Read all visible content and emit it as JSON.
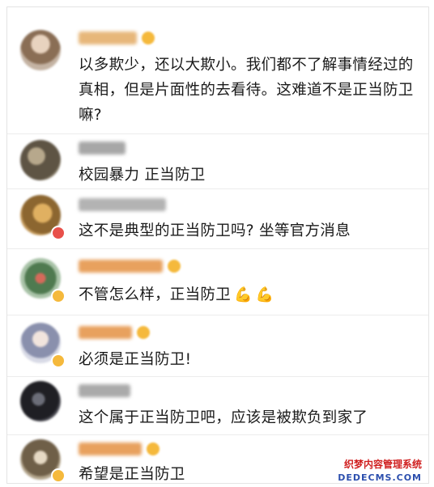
{
  "comments": [
    {
      "text": "以多欺少，还以大欺小。我们都不了解事情经过的真相，但是片面性的去看待。这难道不是正当防卫嘛?",
      "avatar_color": "#b69a7e",
      "name_color": "#e7b77a"
    },
    {
      "text": "校园暴力  正当防卫",
      "avatar_color": "#786a58",
      "name_color": "#9a9a9a"
    },
    {
      "text": "这不是典型的正当防卫吗? 坐等官方消息",
      "avatar_color": "#a9813e",
      "name_color": "#a8a8a8"
    },
    {
      "text": "不管怎么样，正当防卫",
      "avatar_color": "#5b7d5a",
      "name_color": "#e8a15e",
      "icons": [
        "flexed-biceps-icon",
        "flexed-biceps-icon"
      ]
    },
    {
      "text": "必须是正当防卫!",
      "avatar_color": "#9fa6bf",
      "name_color": "#e8a15e"
    },
    {
      "text": "这个属于正当防卫吧，应该是被欺负到家了",
      "avatar_color": "#2e2e33",
      "name_color": "#a2a2a2"
    },
    {
      "text": "希望是正当防卫",
      "avatar_color": "#8a7a62",
      "name_color": "#e8a15e"
    }
  ],
  "watermark": {
    "line1": "织梦内容管理系统",
    "line2": "DEDECMS.COM"
  }
}
